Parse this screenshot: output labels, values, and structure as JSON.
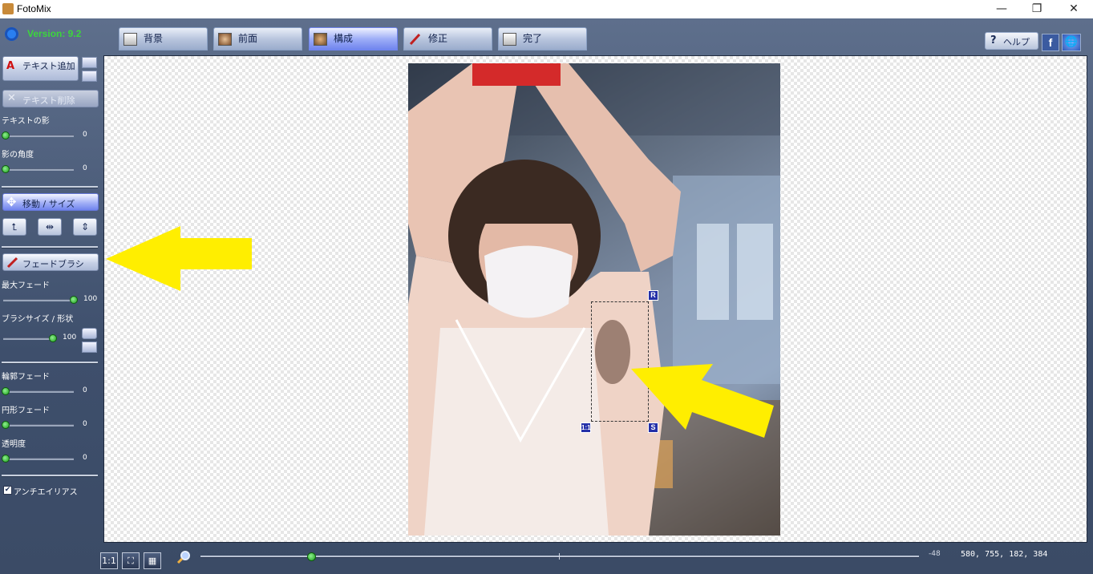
{
  "window": {
    "title": "FotoMix",
    "minimize": "—",
    "restore": "❐",
    "close": "✕"
  },
  "version": "Version: 9.2",
  "tabs": [
    {
      "label": "背景",
      "icon": "background-tab-icon"
    },
    {
      "label": "前面",
      "icon": "foreground-tab-icon"
    },
    {
      "label": "構成",
      "icon": "compose-tab-icon",
      "active": true
    },
    {
      "label": "修正",
      "icon": "retouch-tab-icon"
    },
    {
      "label": "完了",
      "icon": "finish-tab-icon"
    }
  ],
  "topright": {
    "help": "ヘルプ",
    "facebook": "f",
    "web": "🌐"
  },
  "sidebar": {
    "add_text": "テキスト追加",
    "delete_text": "テキスト削除",
    "text_shadow": {
      "label": "テキストの影",
      "value": "0"
    },
    "shadow_angle": {
      "label": "影の角度",
      "value": "0"
    },
    "move_size": "移動 / サイズ",
    "fade_brush": "フェードブラシ",
    "max_fade": {
      "label": "最大フェード",
      "value": "100"
    },
    "brush_size": {
      "label": "ブラシサイズ / 形状",
      "value": "100"
    },
    "edge_fade": {
      "label": "輪郭フェード",
      "value": "0"
    },
    "circle_fade": {
      "label": "円形フェード",
      "value": "0"
    },
    "transparency": {
      "label": "透明度",
      "value": "0"
    },
    "antialias": "アンチエイリアス"
  },
  "selection": {
    "rotate_handle": "R",
    "scale_handle": "S",
    "ratio_handle": "1:1"
  },
  "bottom": {
    "actual_size": "1:1",
    "fit": "⛶",
    "grid": "▦",
    "zoom_value": "-48",
    "zoom_level": 0.155,
    "coords": "580, 755, 182, 384"
  },
  "colors": {
    "accent": "#6f84ee",
    "version_green": "#3cd63c",
    "arrow_yellow": "#ffee00"
  }
}
